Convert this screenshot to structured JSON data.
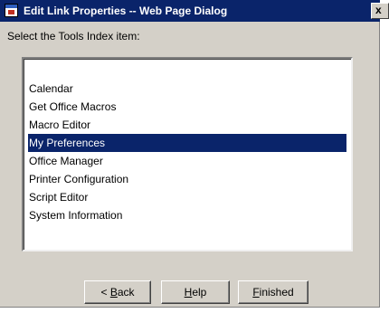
{
  "window": {
    "title": "Edit Link Properties -- Web Page Dialog",
    "close_glyph": "x"
  },
  "prompt": "Select the Tools Index item:",
  "list": {
    "items": [
      "Calendar",
      "Get Office Macros",
      "Macro Editor",
      "My Preferences",
      "Office Manager",
      "Printer Configuration",
      "Script Editor",
      "System Information"
    ],
    "selected_index": 3
  },
  "buttons": {
    "back": {
      "prefix": "< ",
      "mnemonic": "B",
      "rest": "ack"
    },
    "help": {
      "prefix": "",
      "mnemonic": "H",
      "rest": "elp"
    },
    "finished": {
      "prefix": "",
      "mnemonic": "F",
      "rest": "inished"
    }
  },
  "colors": {
    "titlebar": "#0a246a",
    "dialog_face": "#d4d0c8",
    "selection": "#0a246a"
  }
}
